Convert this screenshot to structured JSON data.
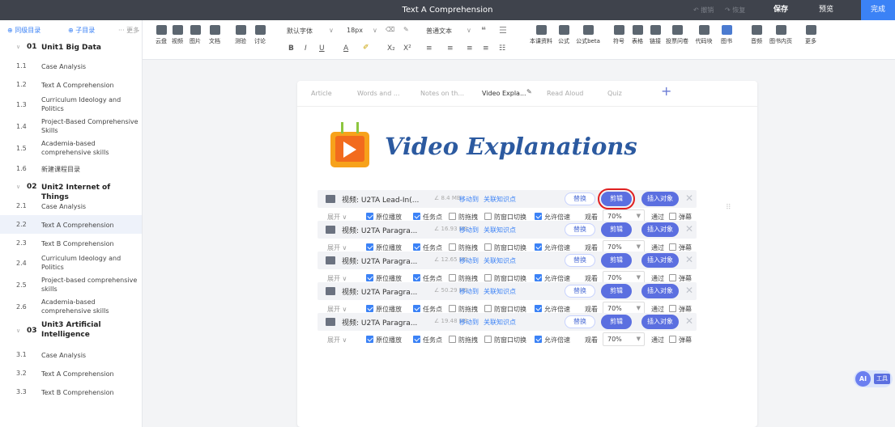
{
  "titlebar": {
    "title": "Text A Comprehension",
    "undo": "↶ 撤销",
    "redo": "↷ 恢复",
    "save": "保存",
    "preview": "预览",
    "done": "完成"
  },
  "sidebar": {
    "add_directory": "⊕ 同级目录",
    "add_subdirectory": "⊕ 子目录",
    "more": "··· 更多",
    "units": [
      {
        "num": "01",
        "title": "Unit1 Big Data",
        "items": [
          {
            "num": "1.1",
            "label": "Case Analysis"
          },
          {
            "num": "1.2",
            "label": "Text A Comprehension"
          },
          {
            "num": "1.3",
            "label": "Curriculum Ideology and Politics"
          },
          {
            "num": "1.4",
            "label": "Project-Based Comprehensive Skills"
          },
          {
            "num": "1.5",
            "label": "Academia-based comprehensive skills"
          },
          {
            "num": "1.6",
            "label": "新建课程目录"
          }
        ]
      },
      {
        "num": "02",
        "title": "Unit2 Internet of Things",
        "items": [
          {
            "num": "2.1",
            "label": "Case Analysis"
          },
          {
            "num": "2.2",
            "label": "Text A Comprehension"
          },
          {
            "num": "2.3",
            "label": "Text B Comprehension"
          },
          {
            "num": "2.4",
            "label": "Curriculum Ideology and Politics"
          },
          {
            "num": "2.5",
            "label": "Project-based comprehensive skills"
          },
          {
            "num": "2.6",
            "label": "Academia-based comprehensive skills"
          }
        ]
      },
      {
        "num": "03",
        "title": "Unit3 Artificial Intelligence",
        "items": [
          {
            "num": "3.1",
            "label": "Case Analysis"
          },
          {
            "num": "3.2",
            "label": "Text A Comprehension"
          },
          {
            "num": "3.3",
            "label": "Text B Comprehension"
          }
        ]
      }
    ]
  },
  "toolbar": {
    "insert_tools": [
      "云盘",
      "视频",
      "图片",
      "文档",
      "测验",
      "讨论"
    ],
    "font_family": "默认字体",
    "font_size": "18px",
    "paragraph_style": "普通文本",
    "format_buttons": [
      "B",
      "I",
      "U",
      "A",
      "X₂",
      "X²"
    ],
    "right_tools": [
      "本课资料",
      "公式",
      "公式beta",
      "符号",
      "表格",
      "链接",
      "投票问卷",
      "代码块",
      "图书",
      "音频",
      "图书内页",
      "更多"
    ]
  },
  "tabs": [
    "Article",
    "Words and ...",
    "Notes on th...",
    "Video Expla...",
    "Read Aloud",
    "Quiz"
  ],
  "active_tab": "Video Expla...",
  "hero_title": "Video Explanations",
  "video_labels": {
    "move": "移动到",
    "link": "关联知识点",
    "replace": "替换",
    "clip": "剪辑",
    "insert": "插入对象",
    "expand": "展开 ∨",
    "opt_original": "原位播放",
    "opt_task": "任务点",
    "opt_drag": "防拖拽",
    "opt_window": "防窗口切换",
    "opt_speed": "允许倍速",
    "watch": "观看",
    "pass": "通过",
    "popup": "弹幕"
  },
  "videos": [
    {
      "name": "视频: U2TA Lead-In(...",
      "size": "∠ 8.4 MB",
      "percent": "70%"
    },
    {
      "name": "视频: U2TA Paragra...",
      "size": "∠ 16.93 MB",
      "percent": "70%"
    },
    {
      "name": "视频: U2TA Paragra...",
      "size": "∠ 12.65 MB",
      "percent": "70%"
    },
    {
      "name": "视频: U2TA Paragra...",
      "size": "∠ 50.29 MB",
      "percent": "70%"
    },
    {
      "name": "视频: U2TA Paragra...",
      "size": "∠ 19.48 MB",
      "percent": "70%"
    }
  ],
  "ai_button": {
    "icon": "AI",
    "label": "工具"
  }
}
